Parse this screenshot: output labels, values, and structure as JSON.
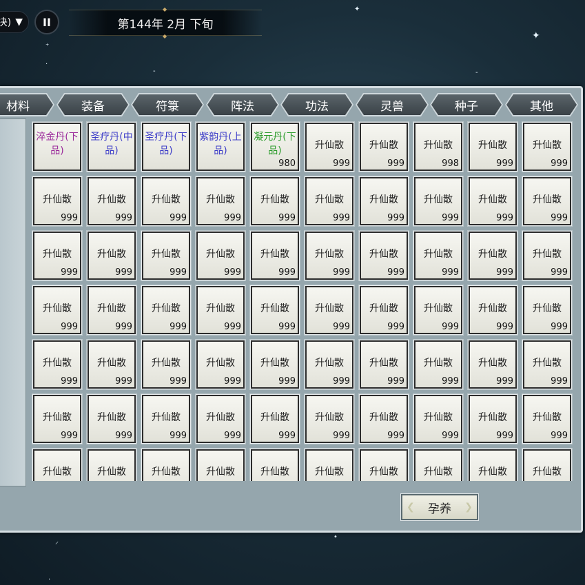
{
  "top_bar": {
    "speed_label": "决)",
    "pause_label": "II",
    "date_text": "第144年 2月 下旬"
  },
  "tabs": [
    "材料",
    "装备",
    "符箓",
    "阵法",
    "功法",
    "灵兽",
    "种子",
    "其他"
  ],
  "confirm_label": "孕养",
  "rarity_colors": {
    "purple": "#9b2a9b",
    "blue": "#3c3cc8",
    "green": "#2a9b2a",
    "default": "#222222"
  },
  "items": [
    {
      "name": "淬金丹(下品)",
      "count": "",
      "rarity": "purple"
    },
    {
      "name": "圣疗丹(中品)",
      "count": "",
      "rarity": "blue"
    },
    {
      "name": "圣疗丹(下品)",
      "count": "",
      "rarity": "blue"
    },
    {
      "name": "紫韵丹(上品)",
      "count": "",
      "rarity": "blue"
    },
    {
      "name": "凝元丹(下品)",
      "count": "980",
      "rarity": "green"
    },
    {
      "name": "升仙散",
      "count": "999",
      "rarity": "default"
    },
    {
      "name": "升仙散",
      "count": "999",
      "rarity": "default"
    },
    {
      "name": "升仙散",
      "count": "998",
      "rarity": "default"
    },
    {
      "name": "升仙散",
      "count": "999",
      "rarity": "default"
    },
    {
      "name": "升仙散",
      "count": "999",
      "rarity": "default"
    },
    {
      "name": "升仙散",
      "count": "999",
      "rarity": "default"
    },
    {
      "name": "升仙散",
      "count": "999",
      "rarity": "default"
    },
    {
      "name": "升仙散",
      "count": "999",
      "rarity": "default"
    },
    {
      "name": "升仙散",
      "count": "999",
      "rarity": "default"
    },
    {
      "name": "升仙散",
      "count": "999",
      "rarity": "default"
    },
    {
      "name": "升仙散",
      "count": "999",
      "rarity": "default"
    },
    {
      "name": "升仙散",
      "count": "999",
      "rarity": "default"
    },
    {
      "name": "升仙散",
      "count": "999",
      "rarity": "default"
    },
    {
      "name": "升仙散",
      "count": "999",
      "rarity": "default"
    },
    {
      "name": "升仙散",
      "count": "999",
      "rarity": "default"
    },
    {
      "name": "升仙散",
      "count": "999",
      "rarity": "default"
    },
    {
      "name": "升仙散",
      "count": "999",
      "rarity": "default"
    },
    {
      "name": "升仙散",
      "count": "999",
      "rarity": "default"
    },
    {
      "name": "升仙散",
      "count": "999",
      "rarity": "default"
    },
    {
      "name": "升仙散",
      "count": "999",
      "rarity": "default"
    },
    {
      "name": "升仙散",
      "count": "999",
      "rarity": "default"
    },
    {
      "name": "升仙散",
      "count": "999",
      "rarity": "default"
    },
    {
      "name": "升仙散",
      "count": "999",
      "rarity": "default"
    },
    {
      "name": "升仙散",
      "count": "999",
      "rarity": "default"
    },
    {
      "name": "升仙散",
      "count": "999",
      "rarity": "default"
    },
    {
      "name": "升仙散",
      "count": "999",
      "rarity": "default"
    },
    {
      "name": "升仙散",
      "count": "999",
      "rarity": "default"
    },
    {
      "name": "升仙散",
      "count": "999",
      "rarity": "default"
    },
    {
      "name": "升仙散",
      "count": "999",
      "rarity": "default"
    },
    {
      "name": "升仙散",
      "count": "999",
      "rarity": "default"
    },
    {
      "name": "升仙散",
      "count": "999",
      "rarity": "default"
    },
    {
      "name": "升仙散",
      "count": "999",
      "rarity": "default"
    },
    {
      "name": "升仙散",
      "count": "999",
      "rarity": "default"
    },
    {
      "name": "升仙散",
      "count": "999",
      "rarity": "default"
    },
    {
      "name": "升仙散",
      "count": "999",
      "rarity": "default"
    },
    {
      "name": "升仙散",
      "count": "999",
      "rarity": "default"
    },
    {
      "name": "升仙散",
      "count": "999",
      "rarity": "default"
    },
    {
      "name": "升仙散",
      "count": "999",
      "rarity": "default"
    },
    {
      "name": "升仙散",
      "count": "999",
      "rarity": "default"
    },
    {
      "name": "升仙散",
      "count": "999",
      "rarity": "default"
    },
    {
      "name": "升仙散",
      "count": "999",
      "rarity": "default"
    },
    {
      "name": "升仙散",
      "count": "999",
      "rarity": "default"
    },
    {
      "name": "升仙散",
      "count": "999",
      "rarity": "default"
    },
    {
      "name": "升仙散",
      "count": "999",
      "rarity": "default"
    },
    {
      "name": "升仙散",
      "count": "999",
      "rarity": "default"
    },
    {
      "name": "升仙散",
      "count": "999",
      "rarity": "default"
    },
    {
      "name": "升仙散",
      "count": "999",
      "rarity": "default"
    },
    {
      "name": "升仙散",
      "count": "999",
      "rarity": "default"
    },
    {
      "name": "升仙散",
      "count": "999",
      "rarity": "default"
    },
    {
      "name": "升仙散",
      "count": "999",
      "rarity": "default"
    },
    {
      "name": "升仙散",
      "count": "999",
      "rarity": "default"
    },
    {
      "name": "升仙散",
      "count": "999",
      "rarity": "default"
    },
    {
      "name": "升仙散",
      "count": "999",
      "rarity": "default"
    },
    {
      "name": "升仙散",
      "count": "999",
      "rarity": "default"
    },
    {
      "name": "升仙散",
      "count": "999",
      "rarity": "default"
    },
    {
      "name": "升仙散",
      "count": "",
      "rarity": "default"
    },
    {
      "name": "升仙散",
      "count": "",
      "rarity": "default"
    },
    {
      "name": "升仙散",
      "count": "",
      "rarity": "default"
    },
    {
      "name": "升仙散",
      "count": "",
      "rarity": "default"
    },
    {
      "name": "升仙散",
      "count": "",
      "rarity": "default"
    },
    {
      "name": "升仙散",
      "count": "",
      "rarity": "default"
    },
    {
      "name": "升仙散",
      "count": "",
      "rarity": "default"
    },
    {
      "name": "升仙散",
      "count": "",
      "rarity": "default"
    },
    {
      "name": "升仙散",
      "count": "",
      "rarity": "default"
    },
    {
      "name": "升仙散",
      "count": "",
      "rarity": "default"
    }
  ]
}
